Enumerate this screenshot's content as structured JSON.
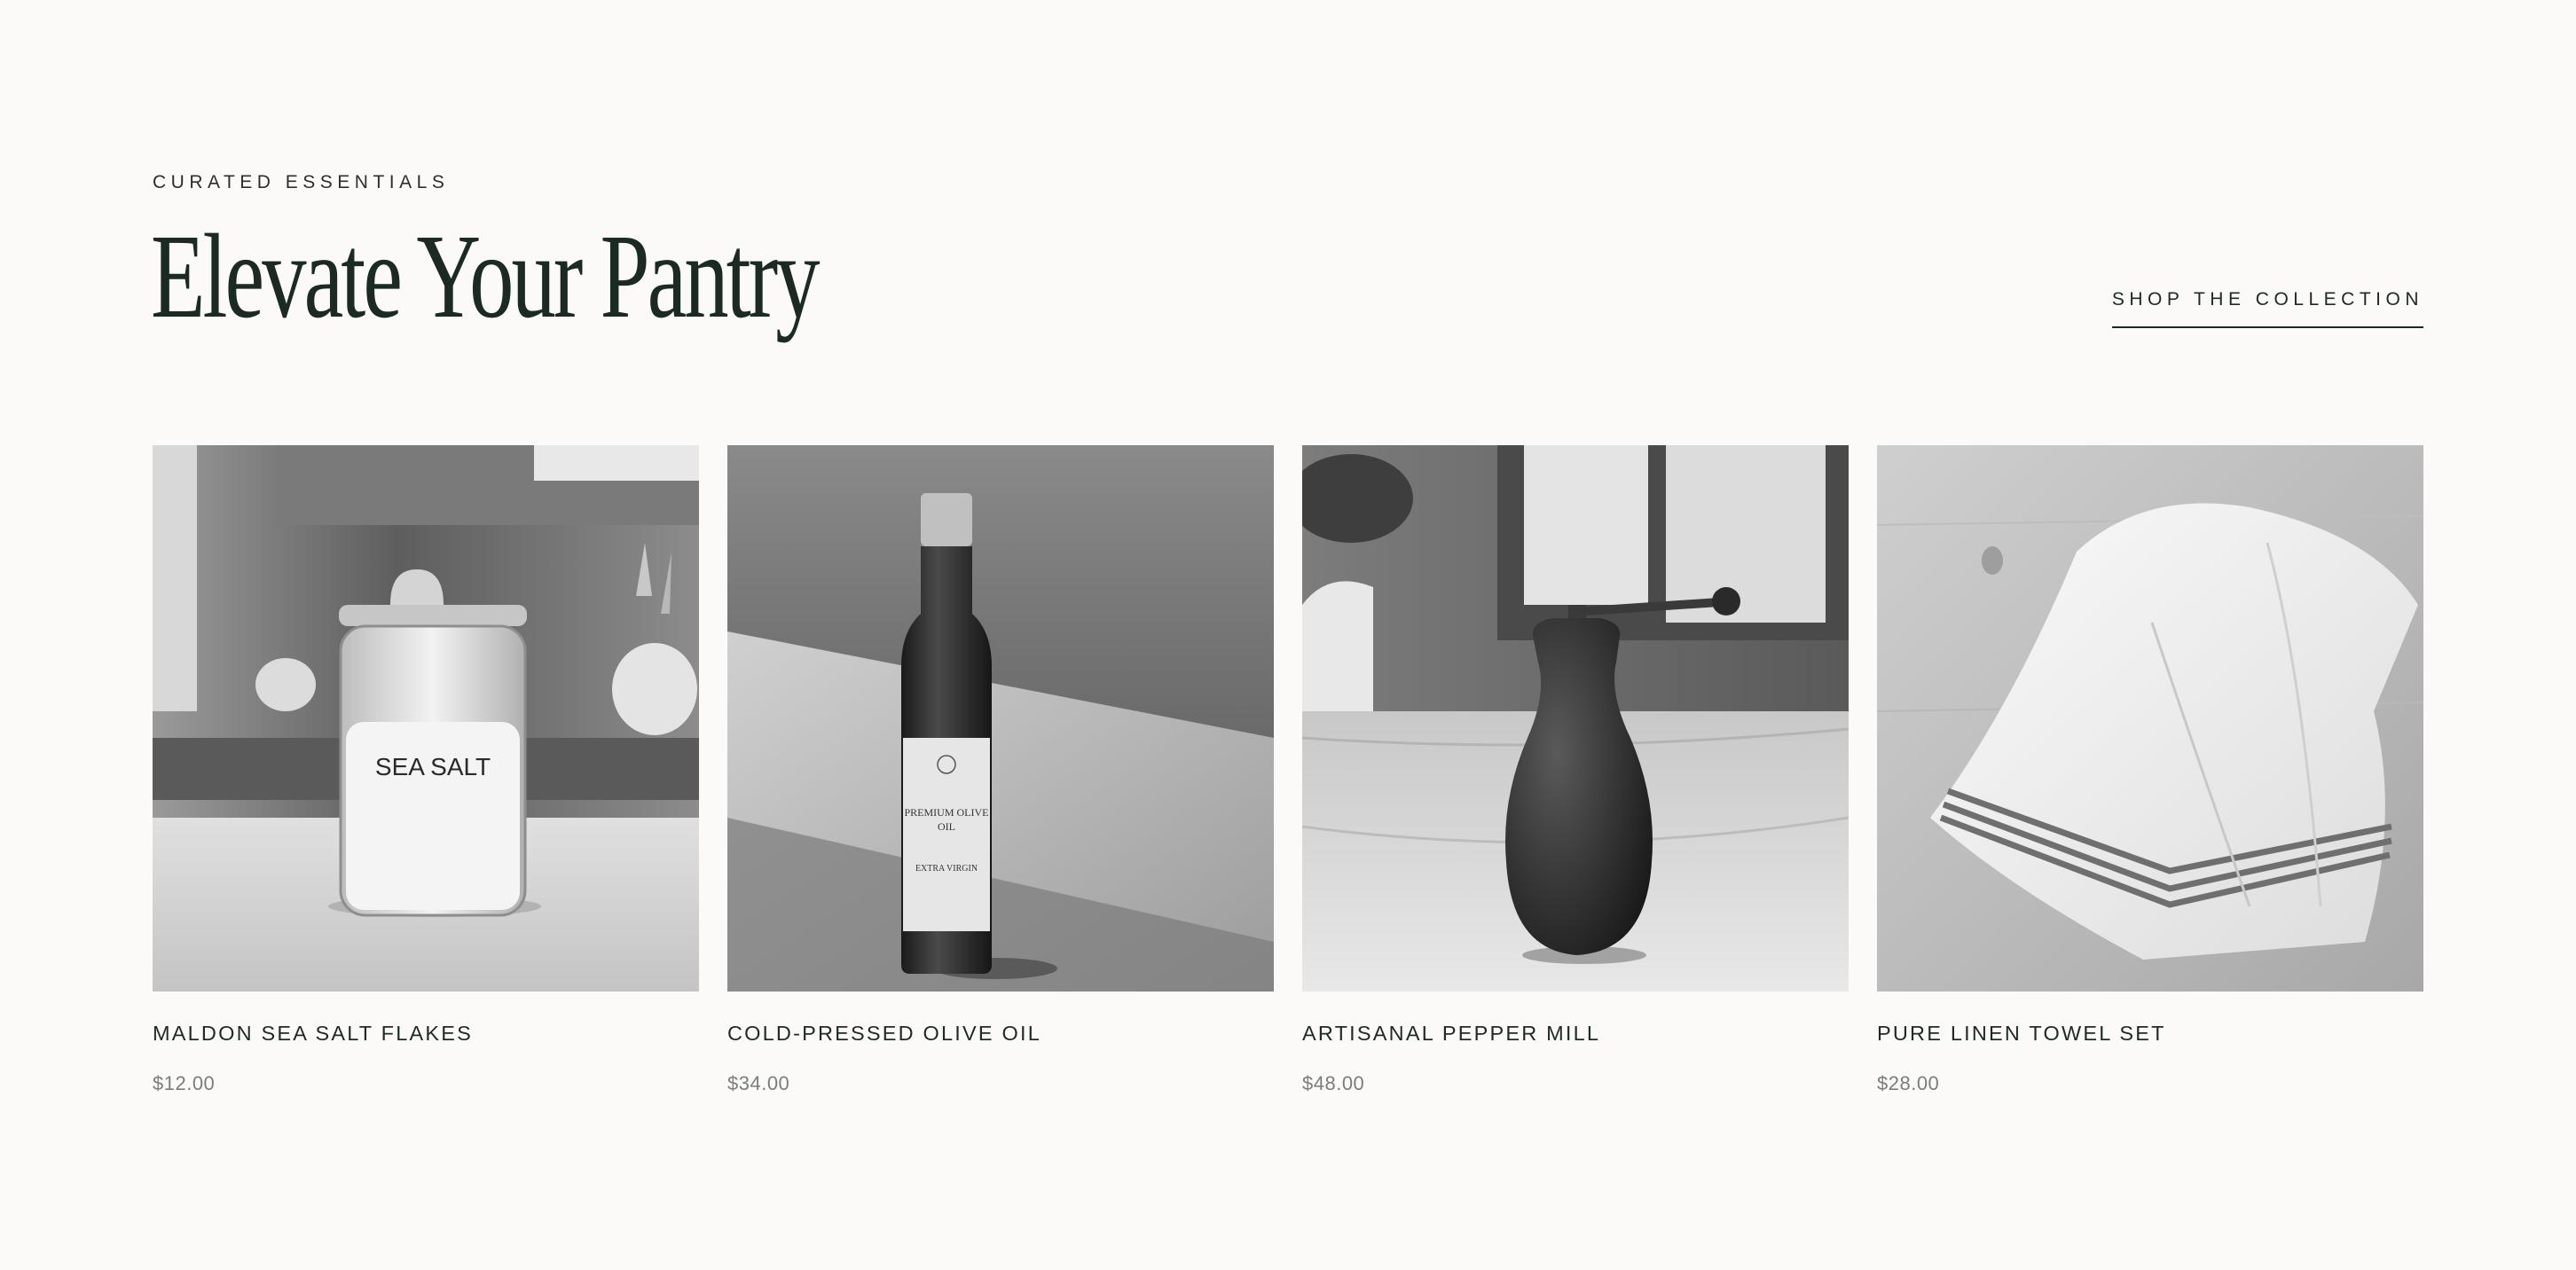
{
  "section": {
    "eyebrow": "CURATED ESSENTIALS",
    "title": "Elevate Your Pantry",
    "cta_label": "SHOP THE COLLECTION"
  },
  "products": [
    {
      "title": "MALDON SEA SALT FLAKES",
      "price": "$12.00",
      "image_text": "SEA SALT"
    },
    {
      "title": "COLD-PRESSED OLIVE OIL",
      "price": "$34.00",
      "label_line1": "PREMIUM OLIVE",
      "label_line2": "OIL",
      "label_line3": "EXTRA VIRGIN"
    },
    {
      "title": "ARTISANAL PEPPER MILL",
      "price": "$48.00"
    },
    {
      "title": "PURE LINEN TOWEL SET",
      "price": "$28.00"
    }
  ],
  "colors": {
    "background": "#fbfaf8",
    "heading": "#1c2b22",
    "price": "#7a7e7b"
  }
}
